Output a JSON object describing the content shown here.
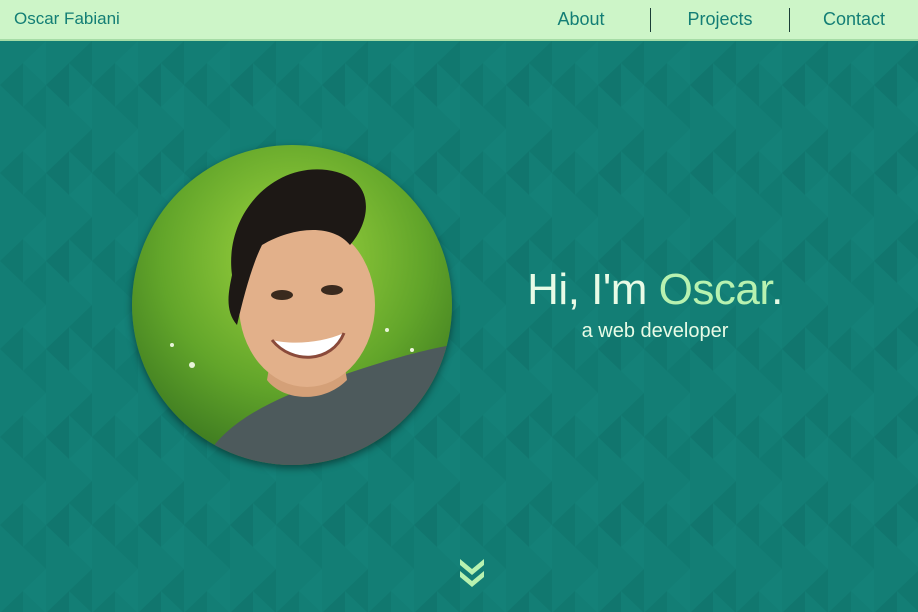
{
  "nav": {
    "brand": "Oscar Fabiani",
    "links": [
      {
        "label": "About"
      },
      {
        "label": "Projects"
      },
      {
        "label": "Contact"
      }
    ]
  },
  "hero": {
    "greeting_prefix": "Hi, I'm ",
    "greeting_name": "Oscar",
    "greeting_suffix": ".",
    "tagline": "a web developer",
    "portrait_alt": "Oscar Fabiani"
  },
  "colors": {
    "background": "#137e75",
    "navbar": "#cdf5c8",
    "accent": "#b7f2b0",
    "text_light": "#e8fbe6"
  },
  "icons": {
    "scroll": "double-chevron-down-icon"
  }
}
